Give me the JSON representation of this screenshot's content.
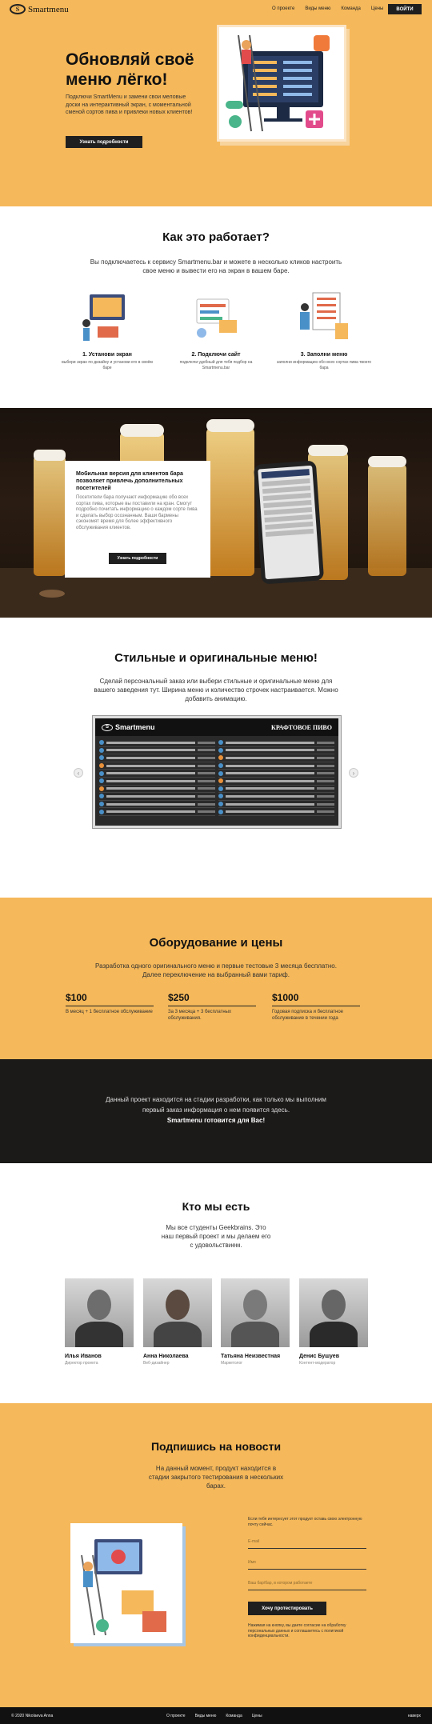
{
  "header": {
    "logo_mark": "S",
    "logo_text": "Smartmenu",
    "nav": [
      "О проекте",
      "Виды меню",
      "Команда",
      "Цены"
    ],
    "login": "ВОЙТИ"
  },
  "hero": {
    "title": "Обновляй своё меню лёгко!",
    "text": "Подключи SmartMenu и замени свои меловые доски на интерактивный экран, с моментальной сменой сортов пива и привлеки новых клиентов!",
    "button": "Узнать подробности"
  },
  "how": {
    "title": "Как это работает?",
    "subtitle": "Вы подключаетесь к сервису Smartmenu.bar и можете в несколько кликов настроить свое меню и вывести его на экран в вашем баре.",
    "steps": [
      {
        "title": "1. Установи экран",
        "desc": "выбери экран по дизайну и установи его в своём баре"
      },
      {
        "title": "2. Подключи сайт",
        "desc": "подключи удобный для тебя подбор на Smartmenu.bar"
      },
      {
        "title": "3. Заполни меню",
        "desc": "заполни информацию обо всех сортах пива твоего бара"
      }
    ]
  },
  "beer": {
    "title": "Мобильная версия для клиентов бара позволяет привлечь дополнительных посетителей",
    "text": "Посетители бара получают информацию обо всех сортах пива, которые вы поставили на кран. Смогут подробно почитать информацию о каждом сорте пива и сделать выбор осознанным. Ваши бармены сэкономят время для более эффективного обслуживания клиентов.",
    "button": "Узнать подробности"
  },
  "menus": {
    "title": "Стильные и оригинальные меню!",
    "subtitle": "Сделай персональный заказ или выбери стильные и оригинальные меню для вашего заведения тут. Ширина меню и количество строчек настраивается. Можно добавить анимацию.",
    "board_logo": "Smartmenu",
    "board_title": "КРАФТОВОЕ ПИВО",
    "prev": "‹",
    "next": "›"
  },
  "pricing": {
    "title": "Оборудование и цены",
    "subtitle": "Разработка одного оригинального меню и первые тестовые 3 месяца бесплатно. Далее переключение на выбранный вами тариф.",
    "plans": [
      {
        "price": "$100",
        "desc": "В месяц + 1 бесплатное обслуживание"
      },
      {
        "price": "$250",
        "desc": "За 3 месяца + 3 бесплатных обслуживания."
      },
      {
        "price": "$1000",
        "desc": "Годовая подписка и бесплатное обслуживание в течении года"
      }
    ]
  },
  "notice": {
    "text": "Данный проект находится на стадии разработки, как только мы выполним первый заказ информация о нем появится здесь.",
    "bold": "Smartmenu готовится для Вас!"
  },
  "team": {
    "title": "Кто мы есть",
    "subtitle": "Мы все студенты Geekbrains. Это наш первый проект и мы делаем его с удовольствием.",
    "members": [
      {
        "name": "Илья Иванов",
        "role": "Директор проекта"
      },
      {
        "name": "Анна Николаева",
        "role": "Веб-дизайнер"
      },
      {
        "name": "Татьяна Неизвестная",
        "role": "Маркетолог"
      },
      {
        "name": "Денис Бушуев",
        "role": "Контент-модератор"
      }
    ]
  },
  "subscribe": {
    "title": "Подпишись на новости",
    "subtitle": "На данный момент, продукт находится в стадии закрытого тестирования в нескольких барах.",
    "intro": "Если тебя интересует этот продукт оставь свою электронную почту сейчас.",
    "email_placeholder": "E-mail",
    "name_placeholder": "Имя",
    "bar_placeholder": "Ваш бар/бар, в котором работаете",
    "button": "Хочу протестировать",
    "note": "Нажимая на кнопку, вы даете согласие на обработку персональных данных и соглашаетесь с политикой конфиденциальности."
  },
  "footer": {
    "copy": "© 2020 Nikolaeva Anna",
    "nav": [
      "О проекте",
      "Виды меню",
      "Команда",
      "Цены"
    ],
    "up": "наверх"
  },
  "colors": {
    "accent": "#f5b85a",
    "dark": "#1f1f1f"
  }
}
